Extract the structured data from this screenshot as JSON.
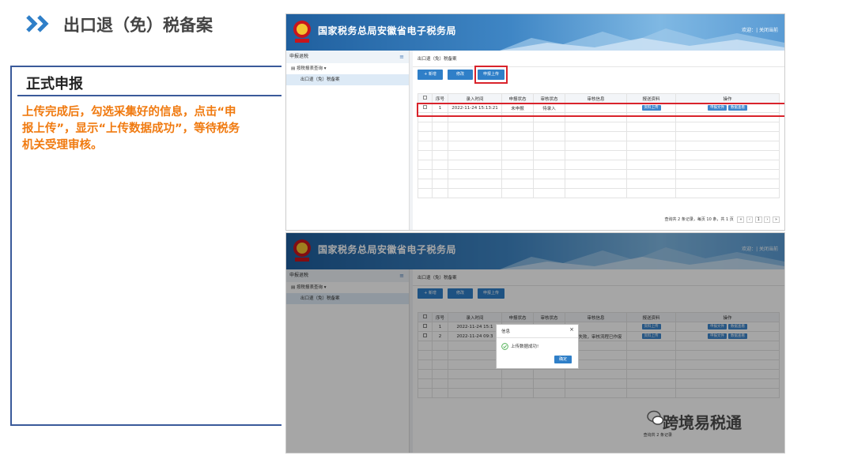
{
  "slide": {
    "title": "出口退（免）税备案",
    "section_heading": "正式申报",
    "description": "上传完成后，勾选采集好的信息，点击“申报上传”，显示“上传数据成功”，等待税务机关受理审核。",
    "watermark": "跨境易税通"
  },
  "portal": {
    "banner_title": "国家税务总局安徽省电子税务局",
    "welcome_text": "欢迎：| 关闭当前",
    "sidebar_heading": "申报退税",
    "sidebar_item": "按税报表查询 ▾",
    "sidebar_subitem": "出口退（免）税备案",
    "breadcrumb": "出口退（免）税备案"
  },
  "toolbar": {
    "add_label": "+ 新增",
    "edit_label": "修改",
    "upload_label": "申报上传"
  },
  "table": {
    "headers": [
      "",
      "序号",
      "录入时间",
      "申报状态",
      "审核状态",
      "审核信息",
      "报送资料",
      "操作"
    ],
    "screen1_row": {
      "seq": "1",
      "time": "2022-11-24 15:13:21",
      "decl_status": "未申报",
      "audit_status": "待录入",
      "audit_info": "",
      "material_btn": "资料上传",
      "op1": "申报文件",
      "op2": "数据查看"
    },
    "screen2_rows": [
      {
        "seq": "1",
        "time": "2022-11-24 15:1",
        "decl_status": "",
        "audit_status": "",
        "audit_info": "",
        "material_btn": "资料上传",
        "op1": "申报文件",
        "op2": "数据查看"
      },
      {
        "seq": "2",
        "time": "2022-11-24 09:3",
        "decl_status": "",
        "audit_status": "",
        "audit_info": "审核失败，审核流程已作废",
        "material_btn": "资料上传",
        "op1": "申报文件",
        "op2": "数据查看"
      }
    ]
  },
  "pager": {
    "summary": "查询共 2 条记录，每页 10 条，共 1 页",
    "page": "1",
    "screen2_summary": "查询共 2 条记录"
  },
  "dialog": {
    "title": "信息",
    "close": "×",
    "message": "上传数据成功!",
    "ok_label": "确定"
  },
  "colors": {
    "accent_blue": "#2f7fc8",
    "highlight_red": "#d9232b",
    "description_orange": "#f07a10",
    "frame_blue": "#3a5a9a"
  },
  "icons": [
    "chevron-double-right-icon",
    "emblem-icon",
    "menu-icon",
    "document-icon",
    "check-circle-icon",
    "close-icon",
    "wechat-icon"
  ]
}
